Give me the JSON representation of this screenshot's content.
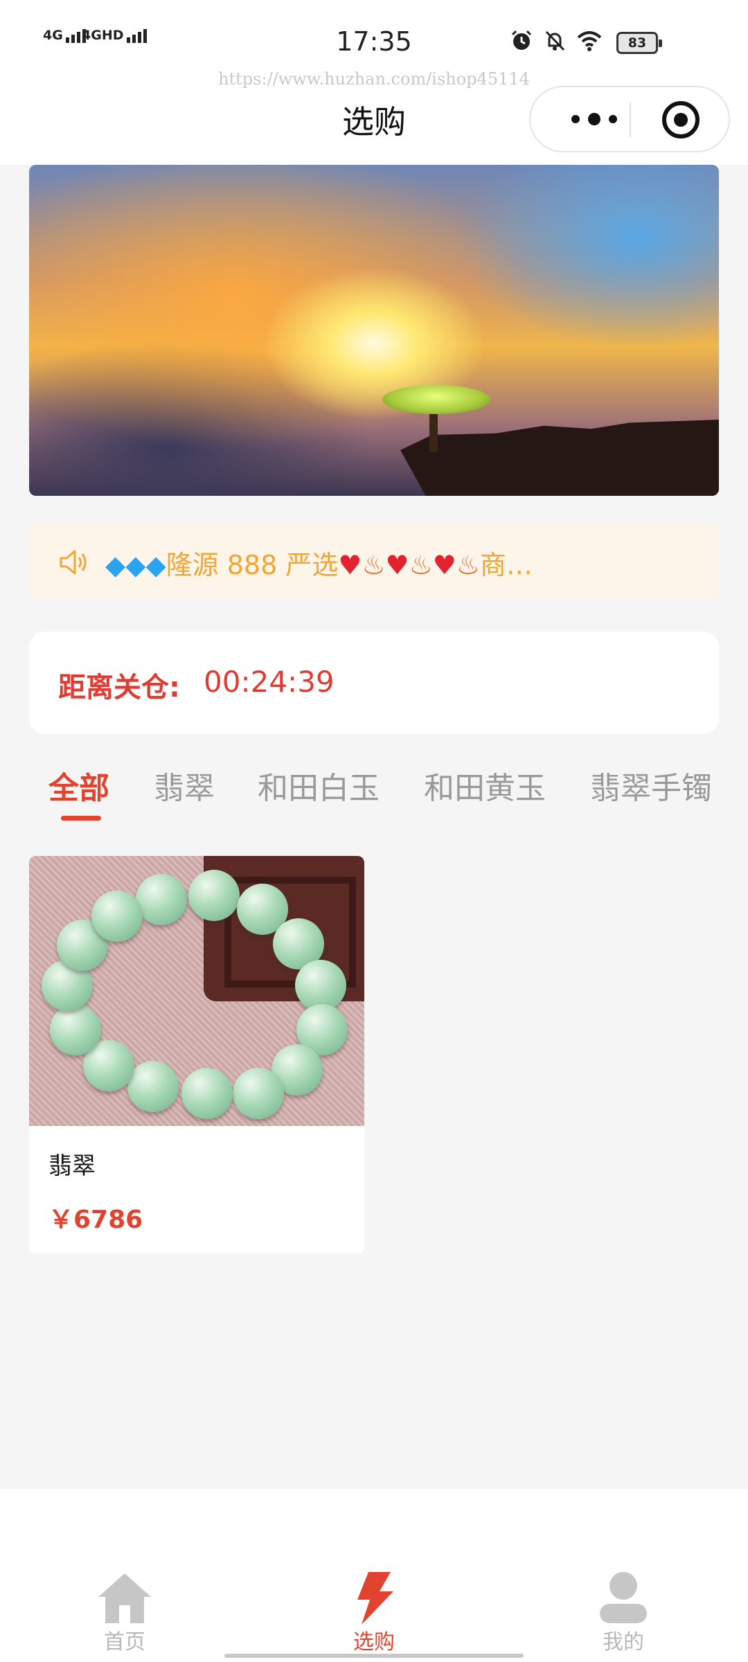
{
  "status_bar": {
    "time": "17:35",
    "signal_1": "4G",
    "signal_2": "4GHD",
    "battery": "83",
    "icons": [
      "alarm-icon",
      "mute-icon",
      "wifi-icon",
      "battery-icon"
    ]
  },
  "nav": {
    "watermark": "https://www.huzhan.com/ishop45114",
    "title": "选购",
    "capsule_icons": [
      "more-icon",
      "close-miniprogram-icon"
    ]
  },
  "notice": {
    "icon": "speaker-icon",
    "text_before": "隆源 888 严选",
    "text_after": "商…"
  },
  "countdown": {
    "label": "距离关仓:",
    "value": "00:24:39"
  },
  "tabs": [
    "全部",
    "翡翠",
    "和田白玉",
    "和田黄玉",
    "翡翠手镯"
  ],
  "products": [
    {
      "name": "翡翠",
      "price": "￥6786"
    }
  ],
  "tabbar": {
    "items": [
      {
        "label": "首页",
        "icon": "home-icon",
        "active": false
      },
      {
        "label": "选购",
        "icon": "lightning-icon",
        "active": true
      },
      {
        "label": "我的",
        "icon": "user-icon",
        "active": false
      }
    ]
  },
  "colors": {
    "accent": "#e2432e",
    "notice_text": "#f3a533",
    "notice_bg": "#fdf5ea",
    "page_bg": "#f5f5f5"
  }
}
